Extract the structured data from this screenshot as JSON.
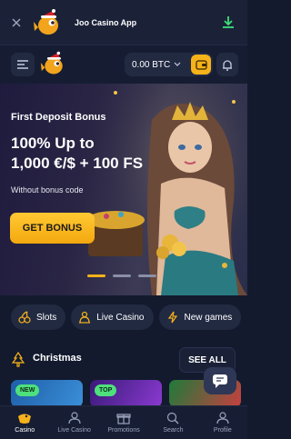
{
  "app_banner": {
    "title": "Joo Casino App",
    "close_icon": "close-icon",
    "download_icon": "download-icon"
  },
  "header": {
    "balance": "0.00 BTC",
    "chevron": "⌄",
    "menu_icon": "menu-icon",
    "wallet_icon": "wallet-icon",
    "bell_icon": "bell-icon"
  },
  "hero": {
    "subtitle": "First Deposit Bonus",
    "headline_line1": "100% Up to",
    "headline_line2": "1,000 €/$ + 100 FS",
    "note": "Without bonus code",
    "cta": "GET BONUS",
    "slides": 3,
    "active_slide": 0
  },
  "categories": [
    {
      "label": "Slots",
      "icon": "cherry-icon"
    },
    {
      "label": "Live Casino",
      "icon": "dealer-icon"
    },
    {
      "label": "New games",
      "icon": "lightning-icon"
    }
  ],
  "section": {
    "title": "Christmas",
    "icon": "christmas-tree-icon",
    "see_all": "SEE ALL"
  },
  "games": [
    {
      "badge": "NEW",
      "color": "#1e5fa8"
    },
    {
      "badge": "TOP",
      "color": "#6a2aa8"
    },
    {
      "badge": "",
      "color": "#1f7a3a"
    }
  ],
  "bottom_nav": [
    {
      "label": "Casino",
      "icon": "casino-icon",
      "active": true
    },
    {
      "label": "Live Casino",
      "icon": "live-casino-icon",
      "active": false
    },
    {
      "label": "Promotions",
      "icon": "gift-icon",
      "active": false
    },
    {
      "label": "Search",
      "icon": "search-icon",
      "active": false
    },
    {
      "label": "Profile",
      "icon": "profile-icon",
      "active": false
    }
  ],
  "colors": {
    "accent": "#f6b21a",
    "background": "#131a2e",
    "surface": "#222a42",
    "badge_green": "#4ee07c"
  }
}
